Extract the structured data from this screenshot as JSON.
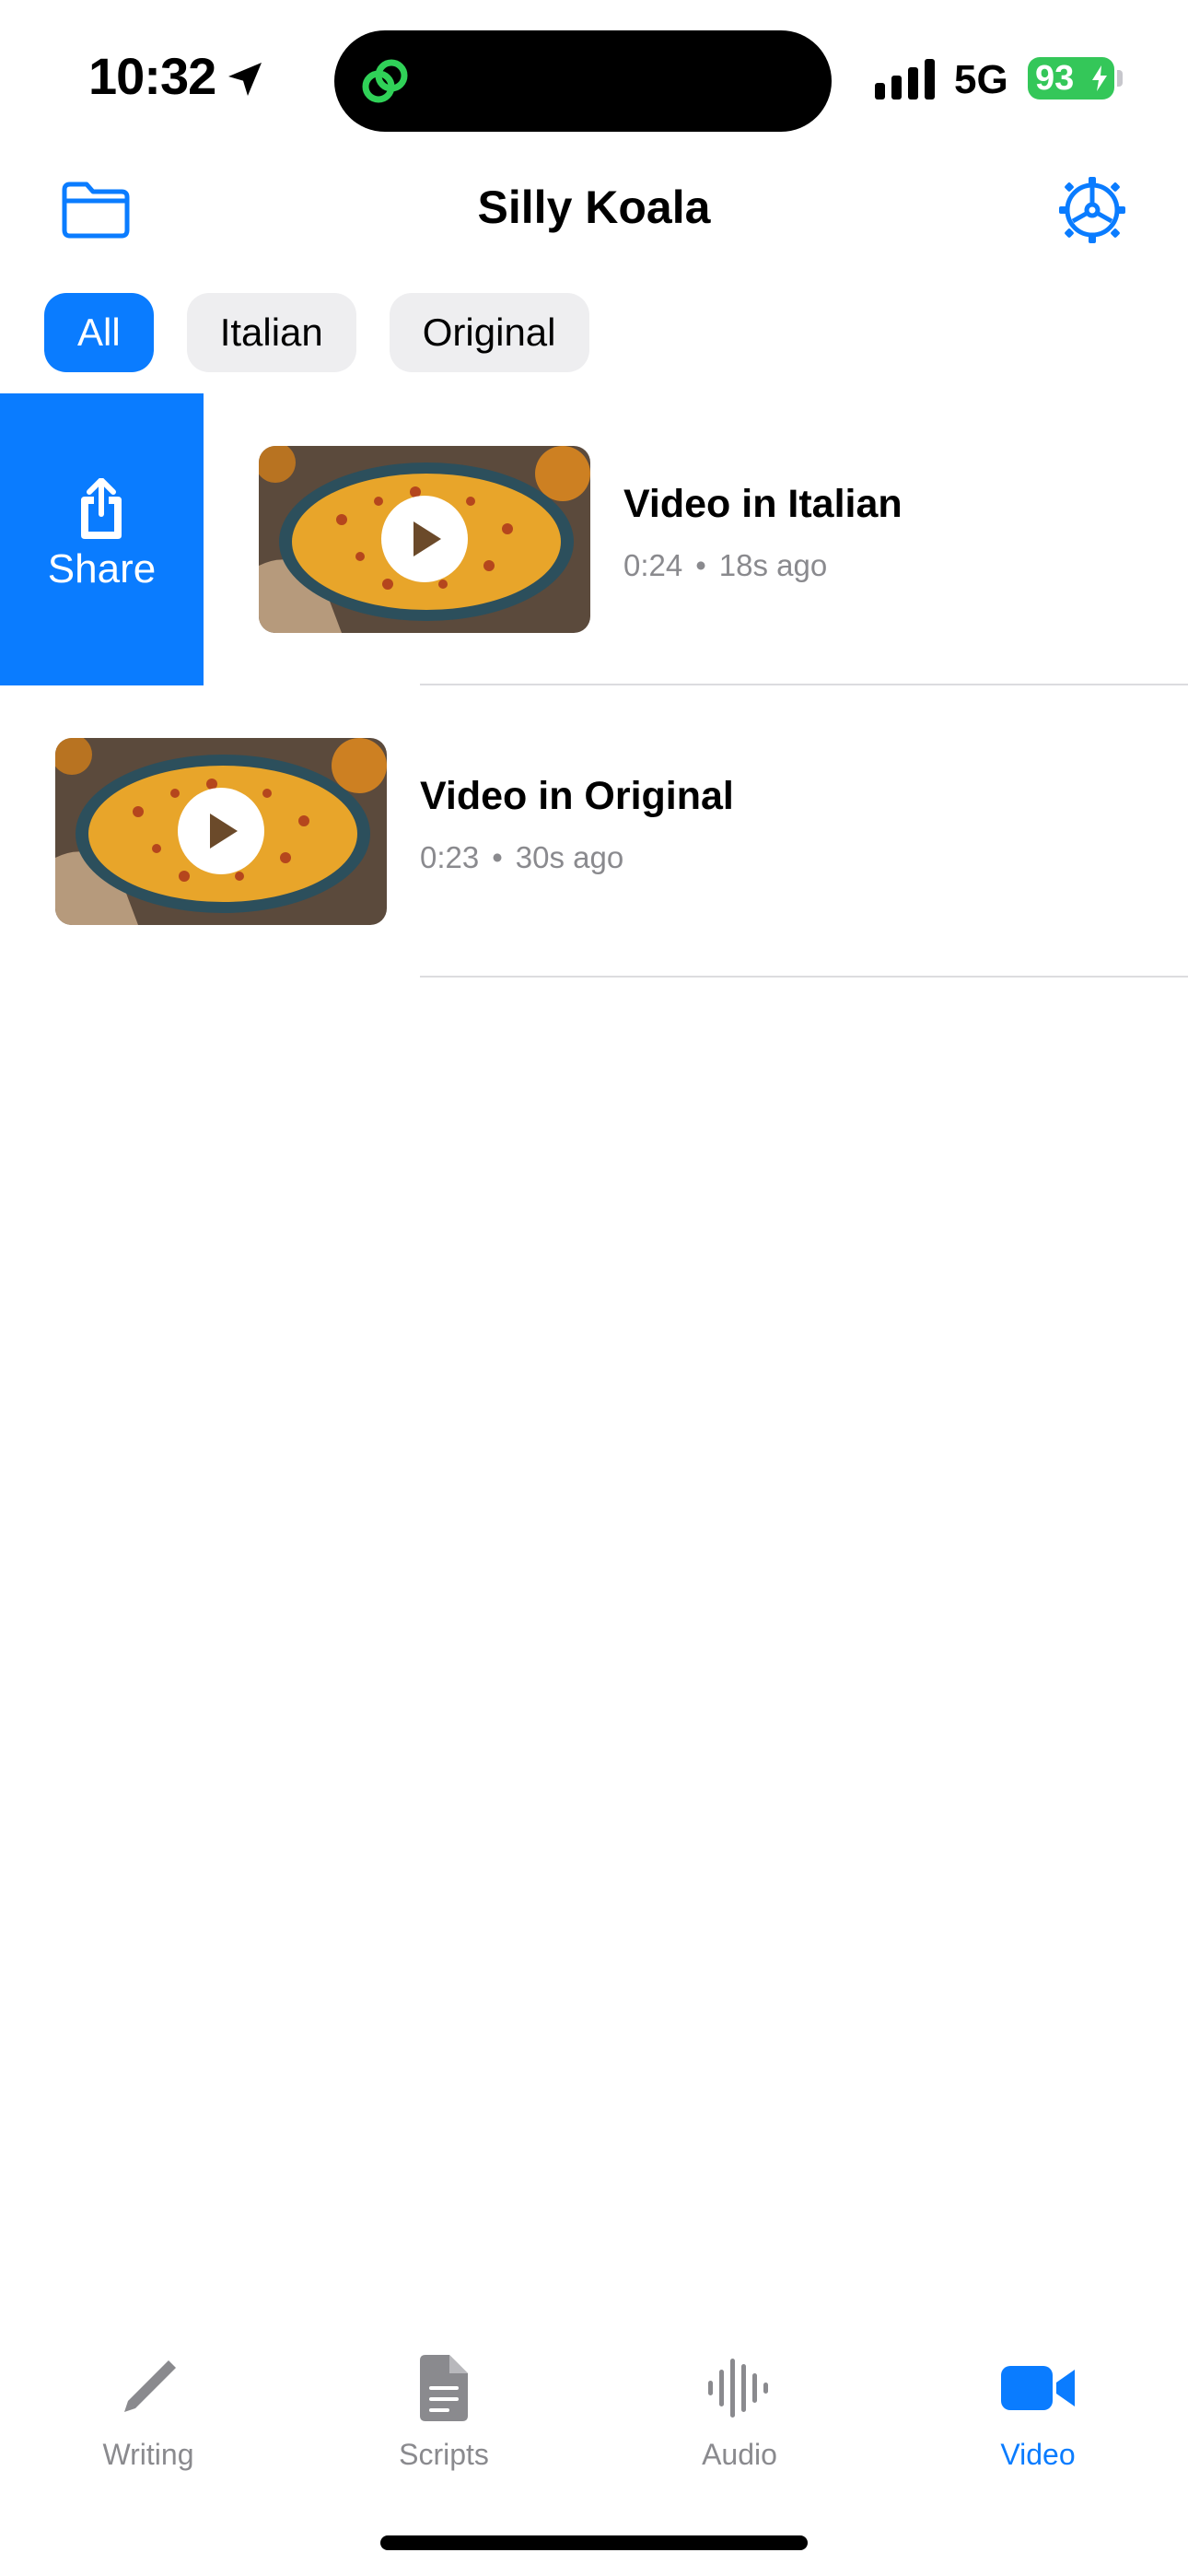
{
  "status_bar": {
    "time": "10:32",
    "network": "5G",
    "battery": "93"
  },
  "header": {
    "title": "Silly Koala",
    "folder_icon": "folder-icon",
    "settings_icon": "gear-icon"
  },
  "filters": {
    "items": [
      {
        "label": "All",
        "selected": true
      },
      {
        "label": "Italian",
        "selected": false
      },
      {
        "label": "Original",
        "selected": false
      }
    ]
  },
  "swipe_action": {
    "label": "Share",
    "icon": "share-icon"
  },
  "videos": [
    {
      "title": "Video in Italian",
      "duration": "0:24",
      "separator": "•",
      "age": "18s ago"
    },
    {
      "title": "Video in Original",
      "duration": "0:23",
      "separator": "•",
      "age": "30s ago"
    }
  ],
  "tab_bar": {
    "tabs": [
      {
        "label": "Writing",
        "icon": "pencil-icon"
      },
      {
        "label": "Scripts",
        "icon": "document-icon"
      },
      {
        "label": "Audio",
        "icon": "waveform-icon"
      },
      {
        "label": "Video",
        "icon": "video-camera-icon",
        "active": true
      }
    ]
  },
  "colors": {
    "accent": "#0a7cff",
    "battery": "#34c759",
    "secondary_text": "#8a8a8e"
  }
}
